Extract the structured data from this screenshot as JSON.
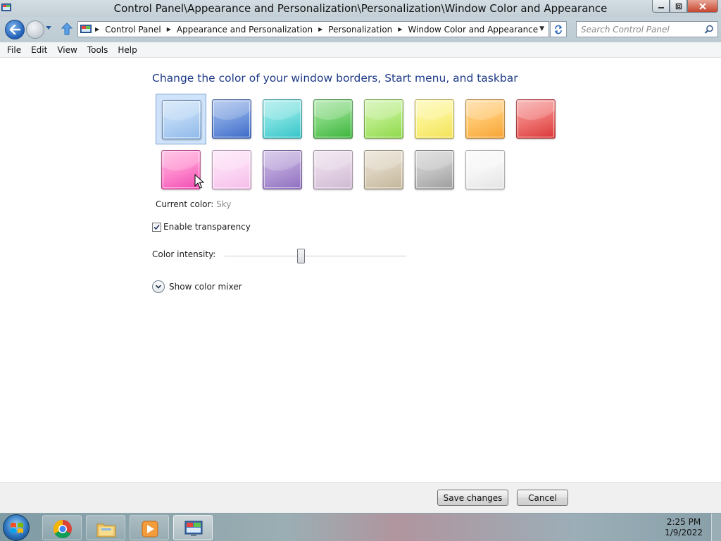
{
  "window": {
    "title": "Control Panel\\Appearance and Personalization\\Personalization\\Window Color and Appearance"
  },
  "address": {
    "breadcrumbs": [
      "Control Panel",
      "Appearance and Personalization",
      "Personalization",
      "Window Color and Appearance"
    ],
    "search_placeholder": "Search Control Panel"
  },
  "menu": [
    "File",
    "Edit",
    "View",
    "Tools",
    "Help"
  ],
  "content": {
    "heading": "Change the color of your window borders, Start menu, and taskbar",
    "swatches": [
      {
        "color": "#b9d6f5",
        "dark": "#8fb8e8"
      },
      {
        "color": "#7b9fe0",
        "dark": "#3d6ac8"
      },
      {
        "color": "#7de0e0",
        "dark": "#36c4c8"
      },
      {
        "color": "#7fd67a",
        "dark": "#3bb33c"
      },
      {
        "color": "#b9ec86",
        "dark": "#8ed84a"
      },
      {
        "color": "#fbf38e",
        "dark": "#f3e25a"
      },
      {
        "color": "#ffc76e",
        "dark": "#f7a434"
      },
      {
        "color": "#f07a78",
        "dark": "#d93737"
      },
      {
        "color": "#ff8fcf",
        "dark": "#f04bb2"
      },
      {
        "color": "#fcd9f4",
        "dark": "#f5bde9"
      },
      {
        "color": "#b79fd8",
        "dark": "#8f6fc0"
      },
      {
        "color": "#e5d4e6",
        "dark": "#cfb8d3"
      },
      {
        "color": "#ddd3bf",
        "dark": "#c3b59a"
      },
      {
        "color": "#c6c6c6",
        "dark": "#9d9d9d"
      },
      {
        "color": "#f6f6f6",
        "dark": "#e4e4e4"
      }
    ],
    "selected_index": 0,
    "current_color_label": "Current color:",
    "current_color_value": "Sky",
    "transparency_label": "Enable transparency",
    "transparency_checked": true,
    "intensity_label": "Color intensity:",
    "intensity_value": 0.42,
    "mixer_label": "Show color mixer"
  },
  "buttons": {
    "save": "Save changes",
    "cancel": "Cancel"
  },
  "taskbar": {
    "apps": [
      "start-orb-icon",
      "chrome-icon",
      "file-explorer-icon",
      "media-player-icon",
      "control-panel-icon"
    ],
    "time": "2:25 PM",
    "date": "1/9/2022"
  }
}
